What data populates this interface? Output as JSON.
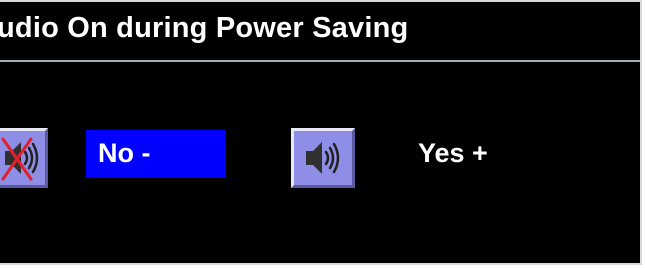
{
  "title": "udio On during Power Saving",
  "options": {
    "no": {
      "label": "No -",
      "icon": "speaker-muted-icon",
      "selected": true
    },
    "yes": {
      "label": "Yes +",
      "icon": "speaker-on-icon",
      "selected": false
    }
  },
  "colors": {
    "background": "#000000",
    "selection": "#0000ff",
    "icon_background": "#8e8ee6",
    "mute_cross": "#e0202a",
    "text": "#ffffff"
  }
}
